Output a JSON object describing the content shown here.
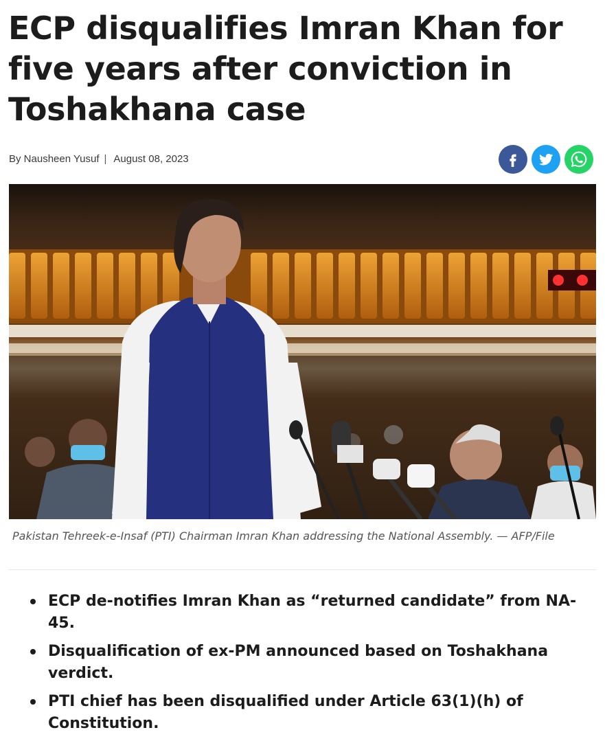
{
  "article": {
    "headline": "ECP disqualifies Imran Khan for five years after conviction in Toshakhana case",
    "byline": {
      "author": "By Nausheen Yusuf",
      "separator": "|",
      "date": "August 08, 2023"
    },
    "share": [
      {
        "network": "facebook",
        "icon": "facebook-icon",
        "color": "#3b5998"
      },
      {
        "network": "twitter",
        "icon": "twitter-icon",
        "color": "#1da1f2"
      },
      {
        "network": "whatsapp",
        "icon": "whatsapp-icon",
        "color": "#25d366"
      }
    ],
    "image": {
      "caption": "Pakistan Tehreek-e-Insaf (PTI) Chairman Imran Khan addressing the National Assembly. — AFP/File"
    },
    "highlights": [
      "ECP de-notifies Imran Khan as “returned candidate” from NA-45.",
      "Disqualification of ex-PM announced based on Toshakhana verdict.",
      "PTI chief has been disqualified under Article 63(1)(h) of Constitution."
    ]
  }
}
